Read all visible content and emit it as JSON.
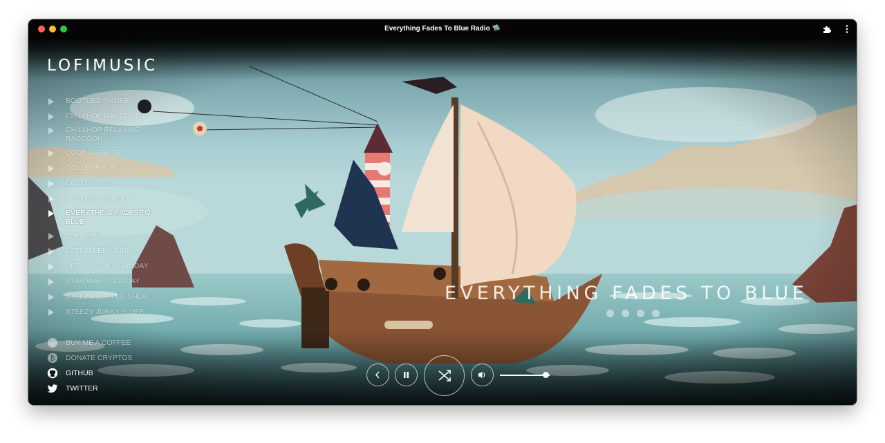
{
  "window": {
    "title": "Everything Fades To Blue Radio 🛸"
  },
  "brand": "LOFIMUSIC",
  "stations": [
    {
      "label": "BOOTLEG SMOKE",
      "active": false
    },
    {
      "label": "CHILLHOP RACCOON",
      "active": false
    },
    {
      "label": "CHILLHOP RELAXING RACCOON",
      "active": false
    },
    {
      "label": "CODING BEATS",
      "active": false
    },
    {
      "label": "COLLEGE GIRL",
      "active": false
    },
    {
      "label": "COLLEGE GUY",
      "active": false
    },
    {
      "label": "COLLEGE LONELY",
      "active": false
    },
    {
      "label": "EVERYTHING FADES TO BLUE",
      "active": true
    },
    {
      "label": "LOFI GIRL",
      "active": false
    },
    {
      "label": "LOFI SLEEPY GIRL",
      "active": false
    },
    {
      "label": "POP CULTURE SUNDAY",
      "active": false
    },
    {
      "label": "STAR WARS SUNDAY",
      "active": false
    },
    {
      "label": "STEEZY COFFEE SHOP",
      "active": false
    },
    {
      "label": "STEEZY JUNKY FLUFF",
      "active": false
    }
  ],
  "links": [
    {
      "label": "BUY ME A COFFEE",
      "icon": "coffee-icon"
    },
    {
      "label": "DONATE CRYPTOS",
      "icon": "bitcoin-icon"
    },
    {
      "label": "GITHUB",
      "icon": "github-icon"
    },
    {
      "label": "TWITTER",
      "icon": "twitter-icon"
    }
  ],
  "now_playing": {
    "title": "EVERYTHING FADES TO BLUE",
    "socials": [
      "instagram-icon",
      "spotify-icon",
      "website-icon",
      "youtube-icon"
    ]
  },
  "player": {
    "volume": 0.92,
    "buttons": [
      "previous-icon",
      "pause-icon",
      "shuffle-icon",
      "volume-icon"
    ]
  },
  "colors": {
    "sky": "#9fc6cc",
    "sea": "#7bb8b8",
    "text": "#ffffff"
  }
}
